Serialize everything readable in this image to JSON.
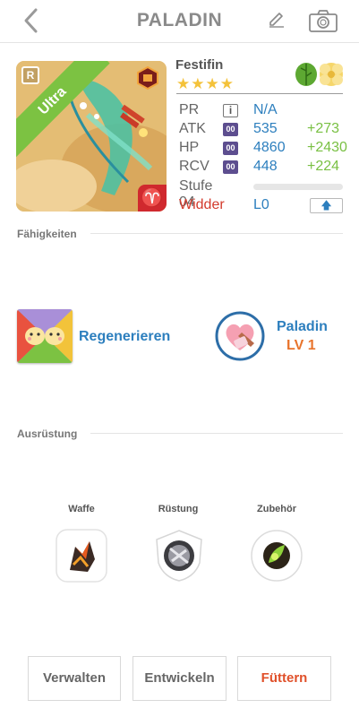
{
  "header": {
    "title": "PALADIN",
    "back_icon": "chevron-left-icon",
    "edit_icon": "pencil-icon",
    "camera_icon": "camera-icon"
  },
  "monster": {
    "name": "Festifin",
    "rarity_label": "Ultra",
    "rarity_badge": "R",
    "stars": "★★★★",
    "star_count": 4,
    "zodiac_glyph": "♈",
    "elements": [
      "leaf-icon",
      "flower-icon"
    ],
    "stats": [
      {
        "label": "PR",
        "box": "i",
        "value": "N/A",
        "plus": ""
      },
      {
        "label": "ATK",
        "box": "00",
        "value": "535",
        "plus": "+273"
      },
      {
        "label": "HP",
        "box": "00",
        "value": "4860",
        "plus": "+2430"
      },
      {
        "label": "RCV",
        "box": "00",
        "value": "448",
        "plus": "+224"
      }
    ],
    "level_label": "Stufe 04",
    "level_progress": 0,
    "sign": "Widder",
    "lv": "L0",
    "upgrade_glyph": "🡅"
  },
  "abilities": {
    "header": "Fähigkeiten",
    "skill_name": "Regenerieren",
    "class_name": "Paladin",
    "class_level": "LV 1"
  },
  "equipment": {
    "header": "Ausrüstung",
    "slots": [
      {
        "label": "Waffe",
        "icon": "weapon-icon"
      },
      {
        "label": "Rüstung",
        "icon": "armor-icon"
      },
      {
        "label": "Zubehör",
        "icon": "accessory-icon"
      }
    ]
  },
  "actions": {
    "manage": "Verwalten",
    "evolve": "Entwickeln",
    "feed": "Füttern"
  },
  "colors": {
    "accent_blue": "#2d7fbe",
    "bonus_green": "#79c043",
    "feed_red": "#e0502a",
    "level_orange": "#e8742c",
    "ultra_green": "#7cc242",
    "star_gold": "#f4c23a"
  }
}
